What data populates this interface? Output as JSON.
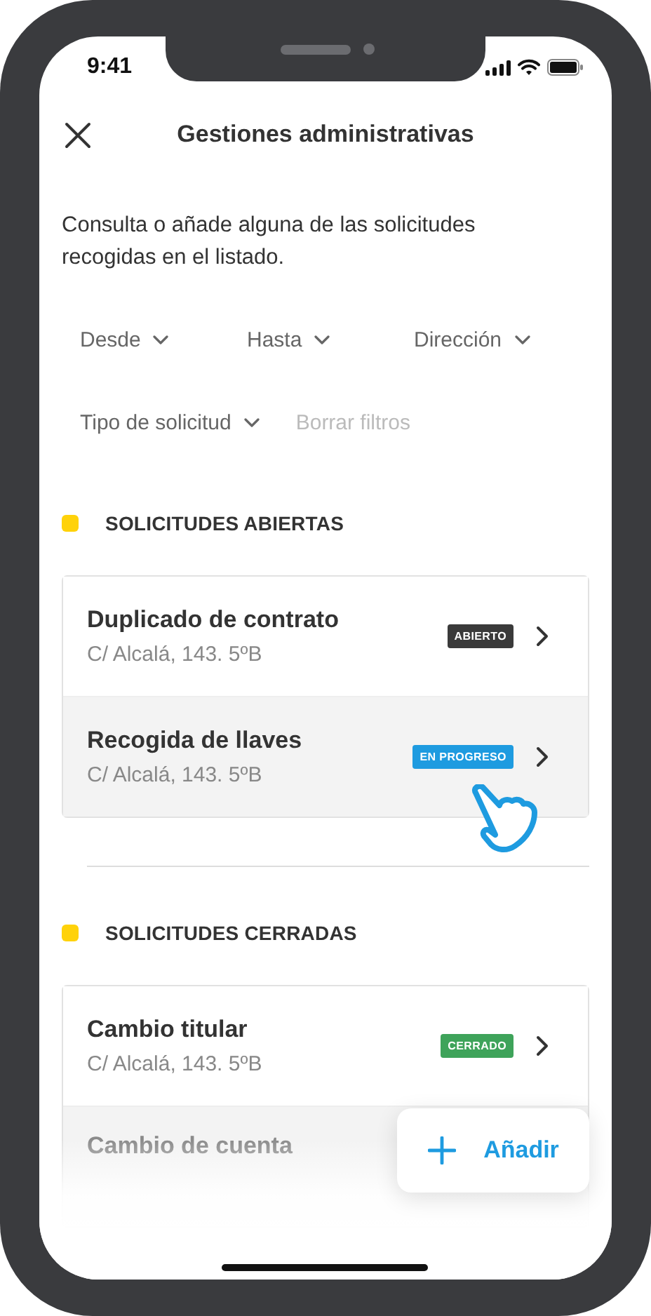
{
  "status_bar": {
    "time": "9:41"
  },
  "header": {
    "title": "Gestiones administrativas"
  },
  "description": "Consulta o añade alguna de las solicitudes recogidas en el listado.",
  "filters": [
    {
      "label": "Desde",
      "kind": "dropdown",
      "disabled": false
    },
    {
      "label": "Hasta",
      "kind": "dropdown",
      "disabled": false
    },
    {
      "label": "Dirección",
      "kind": "dropdown",
      "disabled": false
    },
    {
      "label": "Tipo de solicitud",
      "kind": "dropdown",
      "disabled": false
    },
    {
      "label": "Borrar filtros",
      "kind": "action",
      "disabled": true
    }
  ],
  "sections": [
    {
      "title": "SOLICITUDES ABIERTAS",
      "requests": [
        {
          "title": "Duplicado de contrato",
          "address": "C/ Alcalá, 143. 5ºB",
          "status": "ABIERTO",
          "kind": "open",
          "pressed": false,
          "faded": false
        },
        {
          "title": "Recogida de llaves",
          "address": "C/ Alcalá, 143. 5ºB",
          "status": "EN PROGRESO",
          "kind": "progress",
          "pressed": true,
          "faded": false
        }
      ]
    },
    {
      "title": "SOLICITUDES CERRADAS",
      "requests": [
        {
          "title": "Cambio titular",
          "address": "C/ Alcalá, 143. 5ºB",
          "status": "CERRADO",
          "kind": "closed",
          "pressed": false,
          "faded": false
        },
        {
          "title": "Cambio de cuenta",
          "pressed": false,
          "faded": true
        }
      ]
    }
  ],
  "add_button": {
    "label": "Añadir"
  }
}
